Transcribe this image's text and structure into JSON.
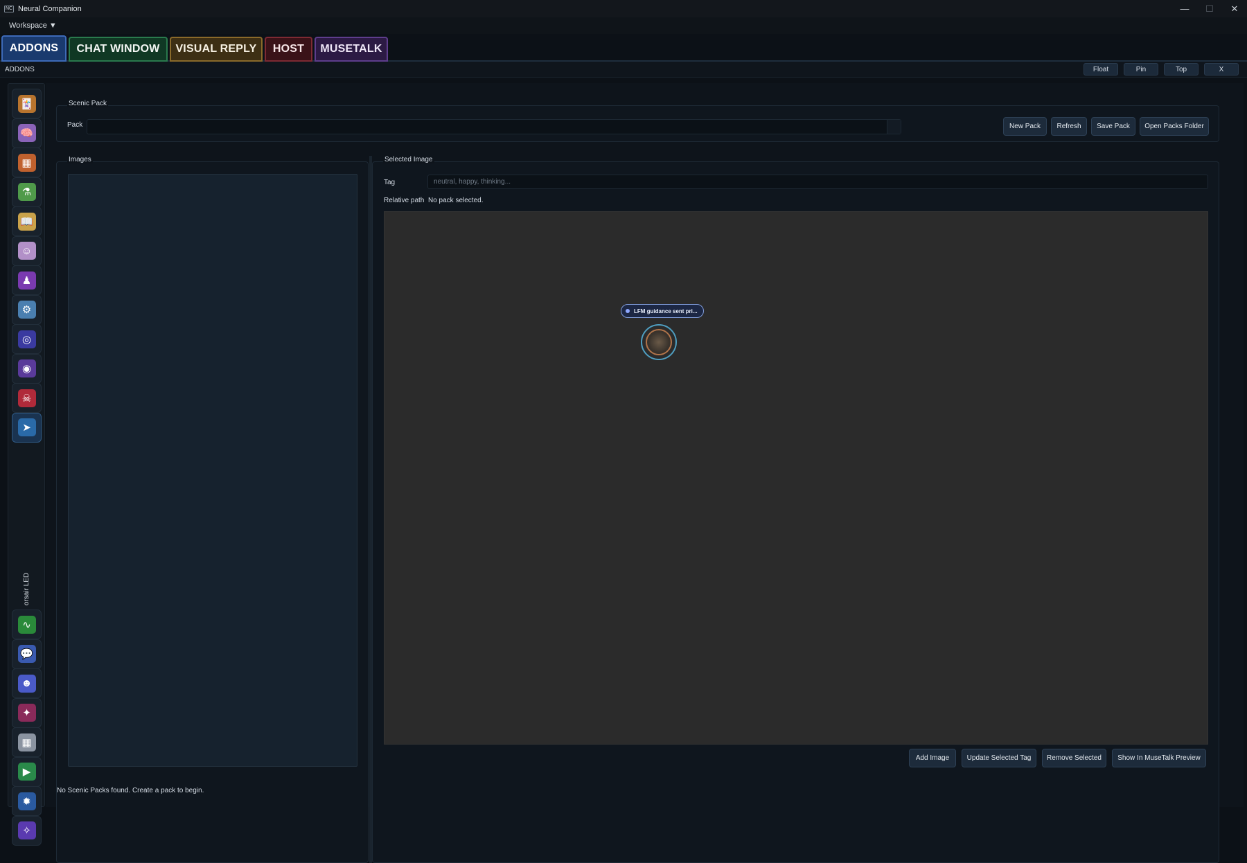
{
  "window": {
    "title": "Neural Companion",
    "logo": "NC",
    "min": "—",
    "max": "☐",
    "close": "✕"
  },
  "menubar": {
    "workspace": "Workspace ▼"
  },
  "tabs": [
    {
      "label": "ADDONS"
    },
    {
      "label": "CHAT WINDOW"
    },
    {
      "label": "VISUAL REPLY"
    },
    {
      "label": "HOST"
    },
    {
      "label": "MUSETALK"
    }
  ],
  "dock": {
    "title": "ADDONS",
    "float": "Float",
    "pin": "Pin",
    "top": "Top",
    "close": "X"
  },
  "sidebar": {
    "items": [
      {
        "icon": "character-cards-icon",
        "glyph": "🃏",
        "color": "#b8742e"
      },
      {
        "icon": "brain-icon",
        "glyph": "🧠",
        "color": "#8a63b8"
      },
      {
        "icon": "dashboard-icon",
        "glyph": "▦",
        "color": "#c0612e"
      },
      {
        "icon": "lab-flask-icon",
        "glyph": "⚗",
        "color": "#4f9a4a"
      },
      {
        "icon": "book-icon",
        "glyph": "📖",
        "color": "#c9a24a"
      },
      {
        "icon": "mask-face-icon",
        "glyph": "☺",
        "color": "#b290c8"
      },
      {
        "icon": "avatar-stage-icon",
        "glyph": "♟",
        "color": "#7a3ab0"
      },
      {
        "icon": "robot-chip-icon",
        "glyph": "⚙",
        "color": "#4a7fb0"
      },
      {
        "icon": "target-orb-icon",
        "glyph": "◎",
        "color": "#3a3aa0"
      },
      {
        "icon": "ring-orb-icon",
        "glyph": "◉",
        "color": "#5a3a9a"
      },
      {
        "icon": "demon-icon",
        "glyph": "☠",
        "color": "#b02a3a"
      },
      {
        "icon": "cursor-screen-icon",
        "glyph": "➤",
        "color": "#2a6aa8"
      },
      {
        "icon": "pulse-icon",
        "glyph": "∿",
        "color": "#2a8a3a"
      },
      {
        "icon": "chat-bubbles-icon",
        "glyph": "💬",
        "color": "#3a5ab0"
      },
      {
        "icon": "discord-icon",
        "glyph": "☻",
        "color": "#4a5ac8"
      },
      {
        "icon": "sparkle-icon",
        "glyph": "✦",
        "color": "#8a2a5a"
      },
      {
        "icon": "keyboard-grid-icon",
        "glyph": "▦",
        "color": "#8a93a0"
      },
      {
        "icon": "play-circle-icon",
        "glyph": "▶",
        "color": "#2a8a4a"
      },
      {
        "icon": "gear-bot-icon",
        "glyph": "✹",
        "color": "#2a5aa0"
      },
      {
        "icon": "puzzle-icon",
        "glyph": "✧",
        "color": "#5a3ab0"
      }
    ],
    "vertical_label": "orsair LED"
  },
  "scenic": {
    "group_title": "Scenic Pack",
    "pack_label": "Pack",
    "buttons": {
      "new": "New Pack",
      "refresh": "Refresh",
      "save": "Save Pack",
      "open": "Open Packs Folder"
    }
  },
  "images": {
    "group_title": "Images"
  },
  "selected": {
    "group_title": "Selected Image",
    "tag_label": "Tag",
    "tag_placeholder": "neutral, happy, thinking...",
    "path_label": "Relative path",
    "path_value": "No pack selected.",
    "pill_text": "LFM guidance sent pri...",
    "buttons": {
      "add": "Add Image",
      "update": "Update Selected Tag",
      "remove": "Remove Selected",
      "show": "Show In MuseTalk Preview"
    }
  },
  "status": "No Scenic Packs found. Create a pack to begin."
}
